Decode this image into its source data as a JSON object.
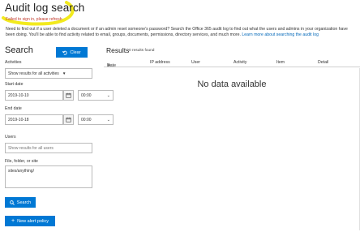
{
  "page": {
    "title": "Audit log search",
    "error": "Failed to sign in, please refresh",
    "intro_text": "Need to find out if a user deleted a document or if an admin reset someone's password? Search the Office 365 audit log to find out what the users and admins in your organization have been doing. You'll be able to find activity related to email, groups, documents, permissions, directory services, and much more.",
    "intro_link": "Learn more about searching the audit log",
    "highlight_color": "#f2ea1d"
  },
  "search": {
    "heading": "Search",
    "clear_label": "Clear",
    "activities_label": "Activities",
    "activities_value": "Show results for all activities",
    "start_label": "Start date",
    "start_date": "2019-10-10",
    "start_time": "00:00",
    "end_label": "End date",
    "end_date": "2019-10-18",
    "end_time": "00:00",
    "users_label": "Users",
    "users_placeholder": "Show results for all users",
    "file_label": "File, folder, or site",
    "file_value": "sites/anything/",
    "search_label": "Search",
    "new_alert_label": "New alert policy"
  },
  "results": {
    "heading": "Results",
    "count": "0 results found",
    "columns": [
      "Date",
      "IP address",
      "User",
      "Activity",
      "Item",
      "Detail"
    ],
    "empty_message": "No data available"
  },
  "icons": {
    "clear": "undo-icon",
    "calendar": "calendar-icon",
    "dropdown": "chevron-down-icon",
    "sort": "sort-desc-icon",
    "add": "plus-icon"
  },
  "colors": {
    "accent": "#0078d4",
    "link": "#0067b8",
    "error": "#c0392b"
  }
}
